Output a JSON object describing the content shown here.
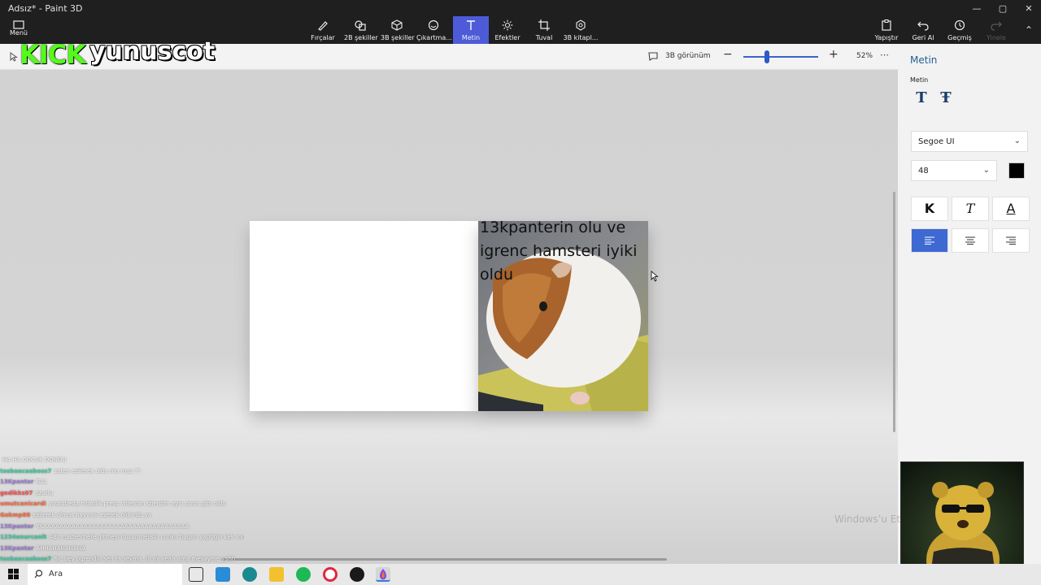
{
  "window": {
    "title": "Adsız* - Paint 3D"
  },
  "menu": {
    "label": "Menü"
  },
  "ribbon": {
    "tools": [
      {
        "label": "Fırçalar",
        "icon": "brush-icon"
      },
      {
        "label": "2B şekiller",
        "icon": "2d-shapes-icon"
      },
      {
        "label": "3B şekiller",
        "icon": "3d-shapes-icon"
      },
      {
        "label": "Çıkartma...",
        "icon": "sticker-icon"
      },
      {
        "label": "Metin",
        "icon": "text-icon",
        "active": true
      },
      {
        "label": "Efektler",
        "icon": "effects-icon"
      },
      {
        "label": "Tuval",
        "icon": "canvas-icon"
      },
      {
        "label": "3B kitapl...",
        "icon": "3d-library-icon"
      }
    ],
    "right": [
      {
        "label": "Yapıştır",
        "icon": "paste-icon"
      },
      {
        "label": "Geri Al",
        "icon": "undo-icon"
      },
      {
        "label": "Geçmiş",
        "icon": "history-icon"
      },
      {
        "label": "Yinele",
        "icon": "redo-icon",
        "disabled": true
      }
    ]
  },
  "subbar": {
    "view3d": "3B görünüm",
    "zoom": "52%",
    "zoom_level": 0.3
  },
  "canvas": {
    "text_lines": [
      "13kpanterin olu ve",
      "igrenc hamsteri iyiki",
      "oldu"
    ]
  },
  "panel": {
    "title": "Metin",
    "section": "Metin",
    "font": "Segoe UI",
    "size": "48",
    "bold_label": "K",
    "italic_label": "T",
    "underline_label": "A",
    "color": "#000000"
  },
  "overlay": {
    "kick": "KICK",
    "streamer": "yunuscot"
  },
  "chat": [
    {
      "user": "",
      "msg": "HA HA COCUK DONDU",
      "color": "#9b7fd6"
    },
    {
      "user": "tosbaacaaboss7",
      "msg": "zaten ezilerek oldu mu mus ??",
      "color": "#3ad0a0"
    },
    {
      "user": "13Kpanter",
      "msg": "BAL",
      "color": "#9b7fd6"
    },
    {
      "user": "gedikks07",
      "msg": "ozurlu",
      "color": "#ff4d4d"
    },
    {
      "user": "umutcanicardi",
      "msg": "youtubeda hidrolik press videoları izlerdim aynı onun gibi oldu",
      "color": "#ff6a3d"
    },
    {
      "user": "Gokmp88",
      "msg": "ezilerek olmus hayvanı ezerek oldurdu ya",
      "color": "#ff6a3d"
    },
    {
      "user": "13Kpanter",
      "msg": "YAAAAAAAAAAAAAAAAAAAAAAAAAAAAAAAAAAAAA",
      "color": "#9b7fd6"
    },
    {
      "user": "1234onurcanlt",
      "msg": "ABI masterchefe gitmeyi dusunmelisin cunku bugun yaptigin kek mubisgt dostum 10 tane felan yerdim herlade olsa lutfen basarilarinin devamini istiyorum",
      "color": "#3ad0a0"
    },
    {
      "user": "13Kpanter",
      "msg": "AHHAHAHAHAHA",
      "color": "#9b7fd6"
    },
    {
      "user": "tosbaacaaboss7",
      "msg": "hic bey ogrendin sen ta seyma. di mi yeah ama mesayme yahh",
      "color": "#3ad0a0"
    }
  ],
  "taskbar": {
    "search": "Ara"
  }
}
